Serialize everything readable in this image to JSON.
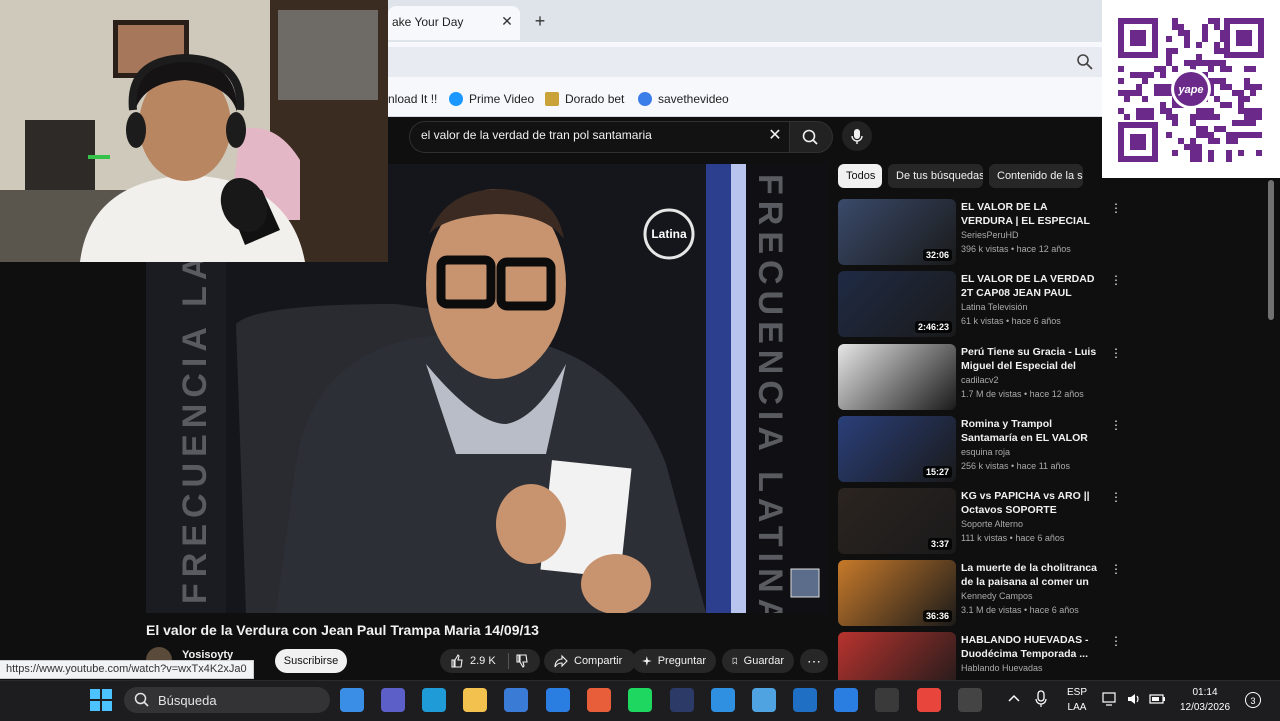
{
  "browser": {
    "tab_title": "ake Your Day",
    "tab_close": "✕",
    "new_tab": "+",
    "bookmarks": [
      {
        "label": "nload It !!",
        "icon": "download-icon"
      },
      {
        "label": "Prime Video",
        "icon": "prime-video-icon"
      },
      {
        "label": "Dorado bet",
        "icon": "dorado-bet-icon"
      },
      {
        "label": "savethevideo",
        "icon": "savethevideo-icon"
      }
    ],
    "status_url": "https://www.youtube.com/watch?v=wxTx4K2xJa0"
  },
  "search": {
    "query": "el valor de la verdad de tran pol santamaria",
    "clear": "✕"
  },
  "video": {
    "title": "El valor de la Verdura con Jean Paul Trampa Maria 14/09/13",
    "channel": "Yosisoyty",
    "subscribe_label": "Suscribirse",
    "likes": "2.9 K",
    "share_label": "Compartir",
    "ask_label": "Preguntar",
    "save_label": "Guardar",
    "more": "⋯",
    "overlay_text_left": "FRECUENCIA LATINA",
    "overlay_text_right": "FRECUENCIA LATINA",
    "logo_text": "Latina"
  },
  "chips": [
    "Todos",
    "De tus búsquedas",
    "Contenido de la se"
  ],
  "recommendations": [
    {
      "title": "EL VALOR DE LA VERDURA | EL ESPECIAL DEL HUMOR ...",
      "channel": "SeriesPeruHD",
      "meta": "396 k vistas • hace 12 años",
      "duration": "32:06",
      "thumb": "#3a4a6a"
    },
    {
      "title": "EL VALOR DE LA VERDAD 2T CAP08 JEAN PAUL SANTA ...",
      "channel": "Latina Televisión",
      "meta": "61 k vistas • hace 6 años",
      "duration": "2:46:23",
      "thumb": "#1f2a44"
    },
    {
      "title": "Perú Tiene su Gracia - Luis Miguel del Especial del Humor...",
      "channel": "cadilacv2",
      "meta": "1.7 M de vistas • hace 12 años",
      "duration": "",
      "thumb": "#e6e6e6"
    },
    {
      "title": "Romina y Trampol Santamaría en EL VALOR DE LA VERDURA...",
      "channel": "esquina roja",
      "meta": "256 k vistas • hace 11 años",
      "duration": "15:27",
      "thumb": "#2a3f7a"
    },
    {
      "title": "KG vs PAPICHA vs ARO || Octavos SOPORTE ALTERNO",
      "channel": "Soporte Alterno",
      "meta": "111 k vistas • hace 6 años",
      "duration": "3:37",
      "thumb": "#2b2420"
    },
    {
      "title": "La muerte de la cholitranca de la paisana al comer un tamal",
      "channel": "Kennedy Campos",
      "meta": "3.1 M de vistas • hace 6 años",
      "duration": "36:36",
      "thumb": "#c77a2a"
    },
    {
      "title": "HABLANDO HUEVADAS - Duodécima Temporada ...",
      "channel": "Hablando Huevadas",
      "meta": "",
      "duration": "",
      "thumb": "#b8332e"
    }
  ],
  "qr": {
    "brand": "yape"
  },
  "taskbar": {
    "search_label": "Búsqueda",
    "lang_top": "ESP",
    "lang_bottom": "LAA",
    "time": "01:14",
    "date": "12/03/2026",
    "notif_count": "3",
    "apps": [
      {
        "name": "task-view-icon",
        "color": "#3a8ee6"
      },
      {
        "name": "teams-icon",
        "color": "#5b5fc7"
      },
      {
        "name": "edge-icon",
        "color": "#1f9bd7"
      },
      {
        "name": "file-explorer-icon",
        "color": "#f2c14e"
      },
      {
        "name": "store-icon",
        "color": "#3a7bd5"
      },
      {
        "name": "mail-icon",
        "color": "#2a7de1"
      },
      {
        "name": "media-player-icon",
        "color": "#e85d3a"
      },
      {
        "name": "spotify-icon",
        "color": "#1ed760"
      },
      {
        "name": "photoshop-icon",
        "color": "#2b3a67"
      },
      {
        "name": "onedrive-icon",
        "color": "#2f8fe0"
      },
      {
        "name": "notepad-icon",
        "color": "#4fa3e0"
      },
      {
        "name": "outlook-icon",
        "color": "#1f6fc5"
      },
      {
        "name": "calendar-icon",
        "color": "#2a7de1"
      },
      {
        "name": "calculator-icon",
        "color": "#3a3a3a"
      },
      {
        "name": "chrome-icon",
        "color": "#e8453c"
      },
      {
        "name": "obs-icon",
        "color": "#444"
      }
    ]
  },
  "colors": {
    "youtube_bg": "#0f0f0f",
    "chip_active": "#f1f1f1",
    "taskbar": "#1d1d1f"
  }
}
